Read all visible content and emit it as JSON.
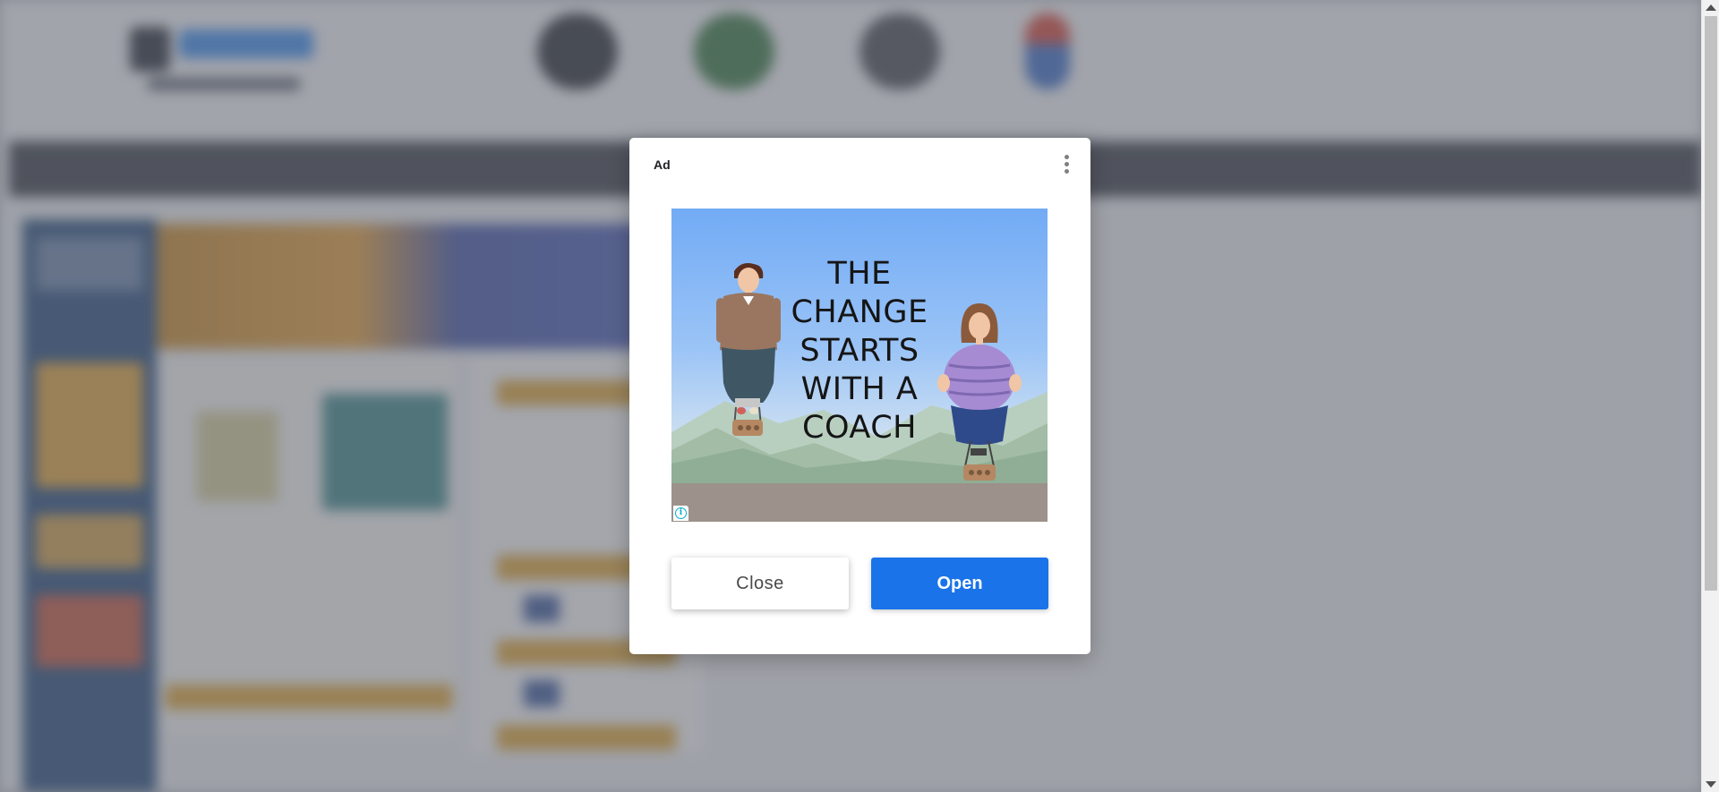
{
  "ad_dialog": {
    "label": "Ad",
    "creative": {
      "headline_lines": [
        "THE",
        "CHANGE",
        "STARTS",
        "WITH A",
        "COACH"
      ],
      "info_icon": "info-icon"
    },
    "buttons": {
      "close_label": "Close",
      "open_label": "Open"
    },
    "menu_icon": "more-vert-icon"
  },
  "colors": {
    "open_button": "#1a73e8",
    "overlay": "#60646e",
    "info_icon": "#00aecd"
  }
}
